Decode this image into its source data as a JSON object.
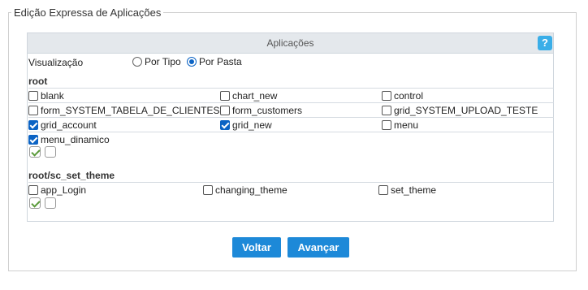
{
  "fieldset_legend": "Edição Expressa de Aplicações",
  "panel": {
    "title": "Aplicações",
    "help_label": "?"
  },
  "view": {
    "label": "Visualização",
    "options": [
      {
        "label": "Por Tipo",
        "selected": false
      },
      {
        "label": "Por Pasta",
        "selected": true
      }
    ]
  },
  "groups": [
    {
      "folder": "root",
      "apps": [
        {
          "label": "blank",
          "checked": false
        },
        {
          "label": "chart_new",
          "checked": false
        },
        {
          "label": "control",
          "checked": false
        },
        {
          "label": "form_SYSTEM_TABELA_DE_CLIENTES",
          "checked": false
        },
        {
          "label": "form_customers",
          "checked": false
        },
        {
          "label": "grid_SYSTEM_UPLOAD_TESTE",
          "checked": false
        },
        {
          "label": "grid_account",
          "checked": true
        },
        {
          "label": "grid_new",
          "checked": true
        },
        {
          "label": "menu",
          "checked": false
        },
        {
          "label": "menu_dinamico",
          "checked": true
        }
      ]
    },
    {
      "folder": "root/sc_set_theme",
      "apps": [
        {
          "label": "app_Login",
          "checked": false
        },
        {
          "label": "changing_theme",
          "checked": false
        },
        {
          "label": "set_theme",
          "checked": false
        }
      ]
    }
  ],
  "buttons": {
    "back": "Voltar",
    "next": "Avançar"
  },
  "colors": {
    "accent": "#1d89d8",
    "help": "#3aaee8",
    "header_bg": "#e4e8ec",
    "check_mark": "#5a9a3a"
  }
}
